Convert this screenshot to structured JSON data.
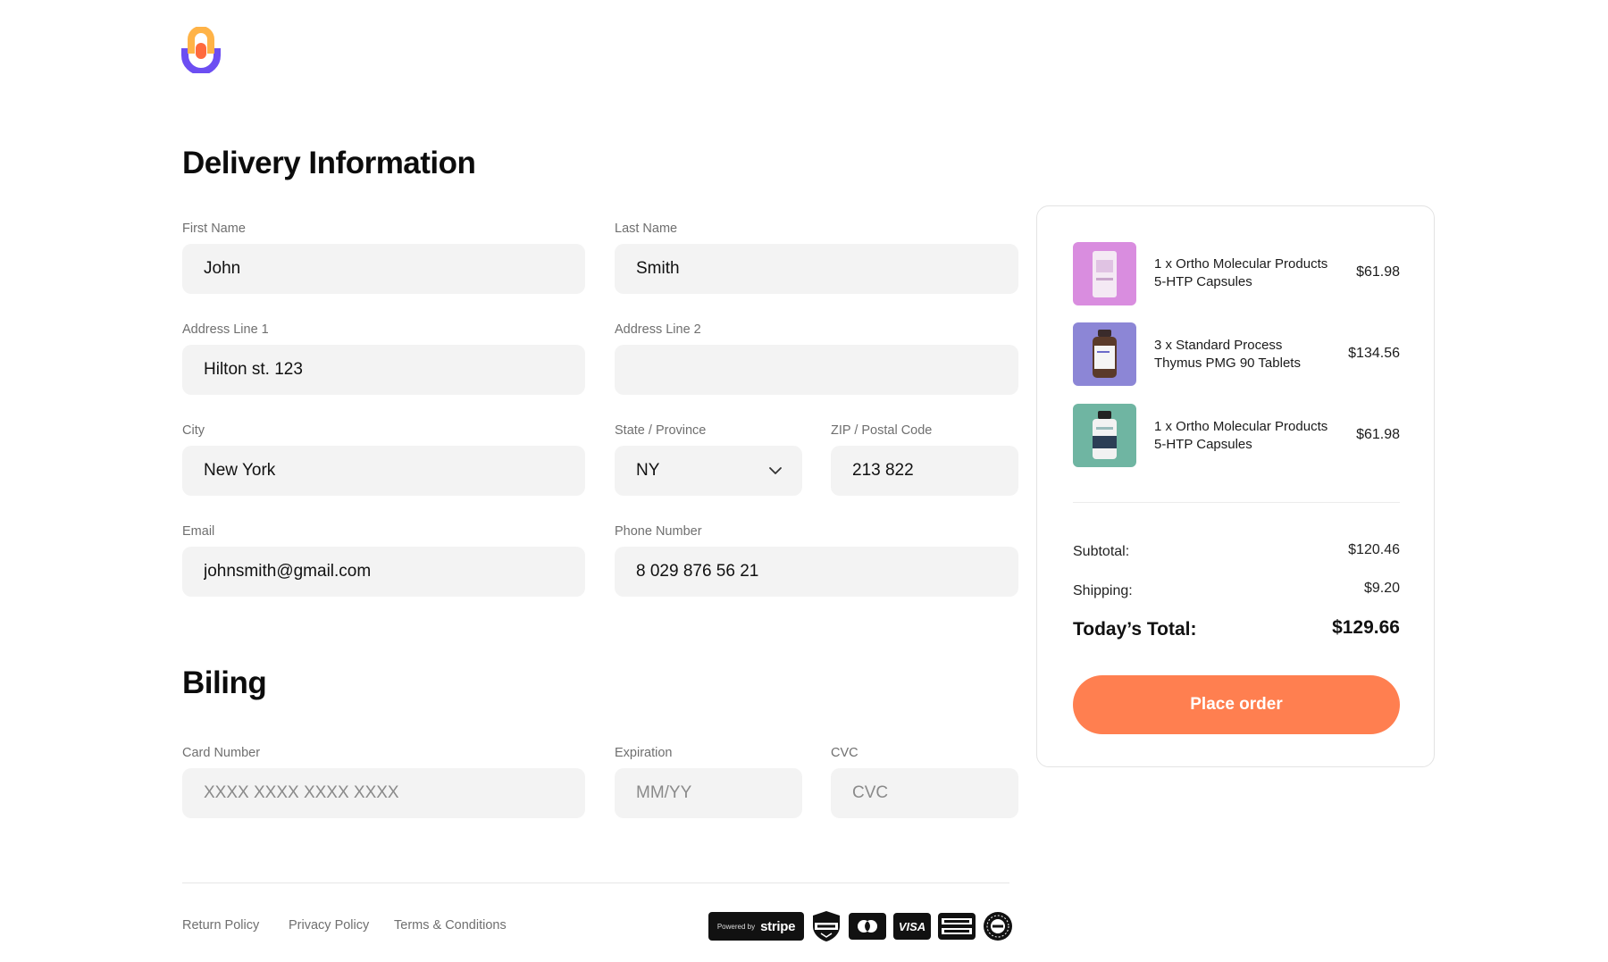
{
  "colors": {
    "accent": "#ff7f50",
    "logo_orange": "#ffa24a",
    "logo_purple": "#6c4ef2",
    "field_bg": "#f3f3f3"
  },
  "logo": {
    "icon": "brand-logo-icon"
  },
  "delivery": {
    "title": "Delivery Information",
    "first_name": {
      "label": "First Name",
      "value": "John"
    },
    "last_name": {
      "label": "Last Name",
      "value": "Smith"
    },
    "address1": {
      "label": "Address Line 1",
      "value": "Hilton st. 123"
    },
    "address2": {
      "label": "Address Line 2",
      "value": ""
    },
    "city": {
      "label": "City",
      "value": "New York"
    },
    "state": {
      "label": "State / Province",
      "value": "NY",
      "icon": "chevron-down-icon"
    },
    "zip": {
      "label": "ZIP / Postal Code",
      "value": "213 822"
    },
    "email": {
      "label": "Email",
      "value": "johnsmith@gmail.com"
    },
    "phone": {
      "label": "Phone Number",
      "value": "8 029 876 56 21"
    }
  },
  "billing": {
    "title": "Biling",
    "card": {
      "label": "Card Number",
      "placeholder": "XXXX XXXX XXXX XXXX"
    },
    "expiration": {
      "label": "Expiration",
      "placeholder": "MM/YY"
    },
    "cvc": {
      "label": "CVC",
      "placeholder": "CVC"
    }
  },
  "footer": {
    "links": [
      "Return Policy",
      "Privacy Policy",
      "Terms & Conditions"
    ],
    "stripe": {
      "powered": "Powered by",
      "brand": "stripe"
    },
    "ssl_icon": "ssl-protection-badge-icon",
    "mastercard_icon": "mastercard-icon",
    "visa": "VISA",
    "amex_icon": "american-express-icon",
    "guarantee_icon": "guarantee-seal-icon"
  },
  "summary": {
    "items": [
      {
        "name": "1 x Ortho Molecular Products 5-HTP Capsules",
        "price": "$61.98",
        "bg": "#d98ddf"
      },
      {
        "name": "3 x Standard Process Thymus PMG 90 Tablets",
        "price": "$134.56",
        "bg": "#8c86d6"
      },
      {
        "name": "1 x Ortho Molecular Products 5-HTP Capsules",
        "price": "$61.98",
        "bg": "#6fb5a2"
      }
    ],
    "subtotal_label": "Subtotal:",
    "subtotal_value": "$120.46",
    "shipping_label": "Shipping:",
    "shipping_value": "$9.20",
    "total_label": "Today’s Total:",
    "total_value": "$129.66",
    "place_order": "Place order"
  }
}
